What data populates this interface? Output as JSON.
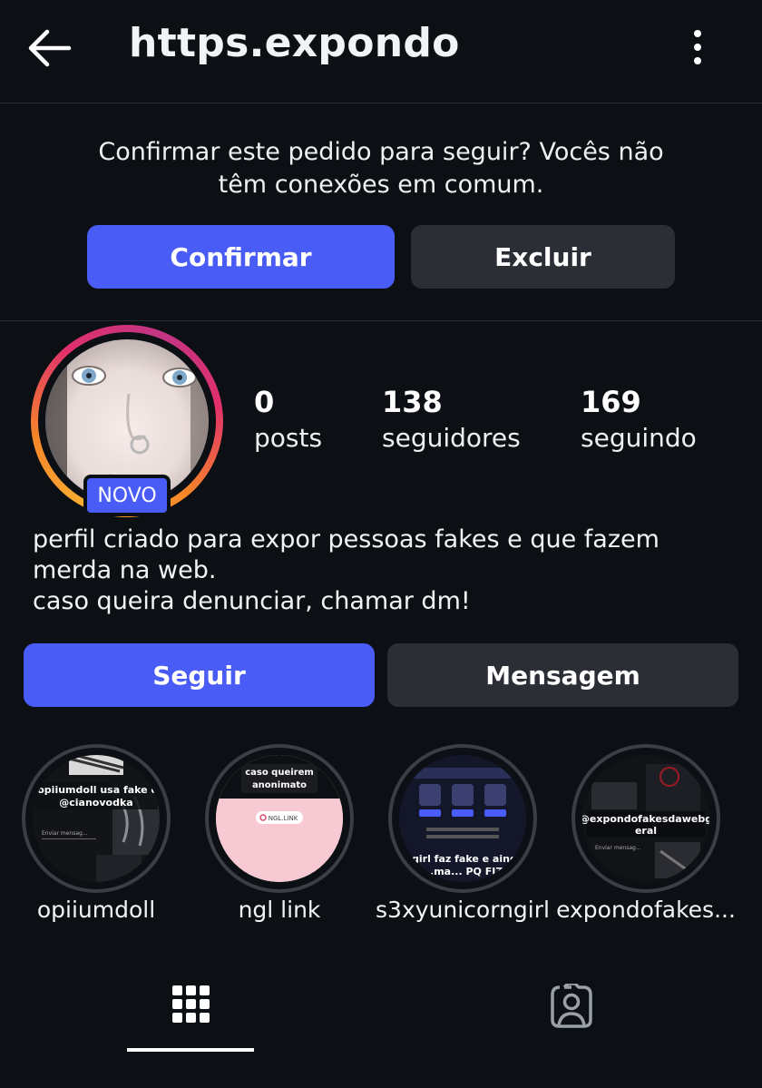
{
  "header": {
    "title": "https.expondo",
    "back_icon": "arrow-left-icon",
    "more_icon": "vertical-dots-icon"
  },
  "follow_request": {
    "message_line1": "Confirmar este pedido para seguir? Vocês não",
    "message_line2": "têm conexões em comum.",
    "confirm_label": "Confirmar",
    "delete_label": "Excluir"
  },
  "profile": {
    "badge": "NOVO",
    "stats": [
      {
        "value": "0",
        "label": "posts"
      },
      {
        "value": "138",
        "label": "seguidores"
      },
      {
        "value": "169",
        "label": "seguindo"
      }
    ],
    "bio": [
      "perfil criado para expor pessoas fakes e que fazem",
      "merda na web.",
      "caso queira denunciar, chamar dm!"
    ],
    "follow_label": "Seguir",
    "message_label": "Mensagem"
  },
  "highlights": [
    {
      "label": "opiiumdoll",
      "caption": "@opiiumdoll usa fake da @cianovodka",
      "input_hint": "Enviar mensag..."
    },
    {
      "label": "ngl link",
      "caption": "caso queirem anonimato",
      "link_text": "NGL.LINK"
    },
    {
      "label": "s3xyunicorngirl",
      "caption": "a girl faz fake e ainda ...ma... PQ FIZ"
    },
    {
      "label": "expondofakes...",
      "caption": "@expondofakesdawebgeral",
      "input_hint": "Enviar mensag..."
    }
  ],
  "tabs": {
    "grid_icon": "grid-icon",
    "tagged_icon": "tagged-person-icon"
  },
  "colors": {
    "background": "#0c0f14",
    "primary_button": "#4a5cf6",
    "secondary_button": "#2b2e34",
    "story_ring": "#e1306c"
  }
}
